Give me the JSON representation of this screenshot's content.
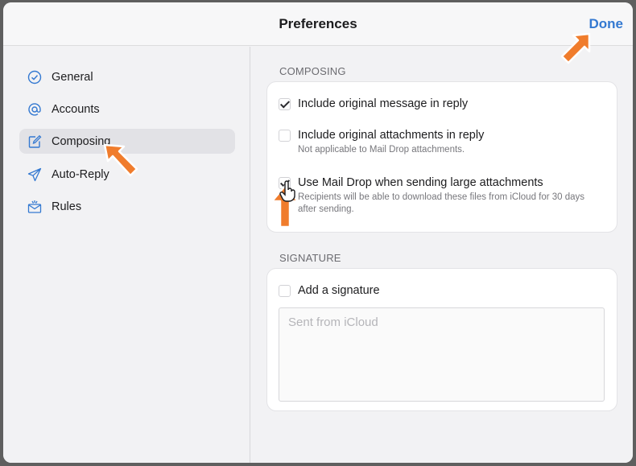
{
  "header": {
    "title": "Preferences",
    "done_label": "Done"
  },
  "sidebar": {
    "items": [
      {
        "label": "General",
        "icon": "checkmark-circle-icon"
      },
      {
        "label": "Accounts",
        "icon": "at-sign-icon"
      },
      {
        "label": "Composing",
        "icon": "compose-icon",
        "selected": true
      },
      {
        "label": "Auto-Reply",
        "icon": "airplane-icon"
      },
      {
        "label": "Rules",
        "icon": "envelope-rules-icon"
      }
    ]
  },
  "composing": {
    "header": "COMPOSING",
    "options": [
      {
        "label": "Include original message in reply",
        "checked": true
      },
      {
        "label": "Include original attachments in reply",
        "sublabel": "Not applicable to Mail Drop attachments.",
        "checked": false
      },
      {
        "label": "Use Mail Drop when sending large attachments",
        "sublabel": "Recipients will be able to download these files from iCloud for 30 days after sending.",
        "checked": true
      }
    ]
  },
  "signature": {
    "header": "SIGNATURE",
    "add_label": "Add a signature",
    "add_checked": false,
    "placeholder": "Sent from iCloud"
  },
  "colors": {
    "accent": "#3479d1",
    "arrow": "#f07c2c",
    "window_bg": "#f2f2f4"
  }
}
